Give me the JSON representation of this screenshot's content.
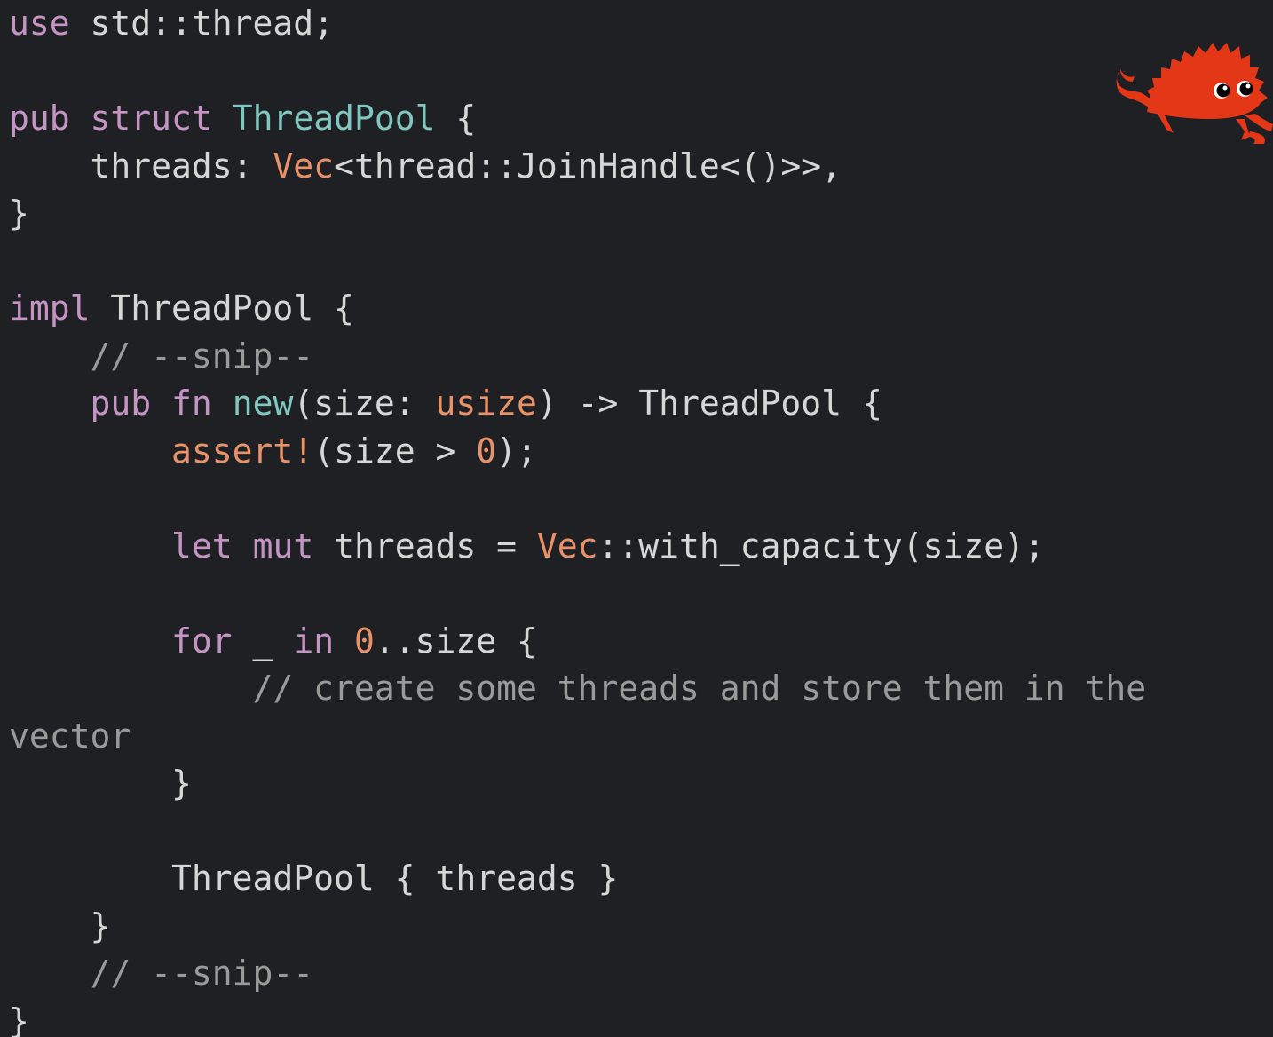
{
  "colors": {
    "background": "#1f2023",
    "default_text": "#d6d6d6",
    "keyword": "#c594c5",
    "type": "#7fc7bf",
    "builtin": "#e9926a",
    "comment": "#9a9a9a",
    "mascot": "#e43717"
  },
  "mascot": {
    "icon": "ferris-crab-icon"
  },
  "code": {
    "language": "rust",
    "lines": [
      [
        {
          "t": "use",
          "k": "keyword"
        },
        {
          "t": " std::thread;",
          "k": "default"
        }
      ],
      [],
      [
        {
          "t": "pub",
          "k": "keyword"
        },
        {
          "t": " ",
          "k": "default"
        },
        {
          "t": "struct",
          "k": "keyword"
        },
        {
          "t": " ",
          "k": "default"
        },
        {
          "t": "ThreadPool",
          "k": "type"
        },
        {
          "t": " {",
          "k": "punct"
        }
      ],
      [
        {
          "t": "    threads: ",
          "k": "default"
        },
        {
          "t": "Vec",
          "k": "builtin"
        },
        {
          "t": "<thread::JoinHandle<()>>,",
          "k": "default"
        }
      ],
      [
        {
          "t": "}",
          "k": "punct"
        }
      ],
      [],
      [
        {
          "t": "impl",
          "k": "keyword"
        },
        {
          "t": " ThreadPool {",
          "k": "default"
        }
      ],
      [
        {
          "t": "    ",
          "k": "default"
        },
        {
          "t": "// --snip--",
          "k": "comment"
        }
      ],
      [
        {
          "t": "    ",
          "k": "default"
        },
        {
          "t": "pub",
          "k": "keyword"
        },
        {
          "t": " ",
          "k": "default"
        },
        {
          "t": "fn",
          "k": "keyword"
        },
        {
          "t": " ",
          "k": "default"
        },
        {
          "t": "new",
          "k": "fn"
        },
        {
          "t": "(size: ",
          "k": "default"
        },
        {
          "t": "usize",
          "k": "builtin"
        },
        {
          "t": ") -> ThreadPool {",
          "k": "default"
        }
      ],
      [
        {
          "t": "        ",
          "k": "default"
        },
        {
          "t": "assert!",
          "k": "macro"
        },
        {
          "t": "(size > ",
          "k": "default"
        },
        {
          "t": "0",
          "k": "number"
        },
        {
          "t": ");",
          "k": "default"
        }
      ],
      [],
      [
        {
          "t": "        ",
          "k": "default"
        },
        {
          "t": "let",
          "k": "keyword"
        },
        {
          "t": " ",
          "k": "default"
        },
        {
          "t": "mut",
          "k": "keyword"
        },
        {
          "t": " threads = ",
          "k": "default"
        },
        {
          "t": "Vec",
          "k": "builtin"
        },
        {
          "t": "::with_capacity(size);",
          "k": "default"
        }
      ],
      [],
      [
        {
          "t": "        ",
          "k": "default"
        },
        {
          "t": "for",
          "k": "keyword"
        },
        {
          "t": " _ ",
          "k": "default"
        },
        {
          "t": "in",
          "k": "keyword"
        },
        {
          "t": " ",
          "k": "default"
        },
        {
          "t": "0",
          "k": "number"
        },
        {
          "t": "..size {",
          "k": "default"
        }
      ],
      [
        {
          "t": "            ",
          "k": "default"
        },
        {
          "t": "// create some threads and store them in the",
          "k": "comment"
        }
      ],
      [
        {
          "t": "vector",
          "k": "comment"
        }
      ],
      [
        {
          "t": "        }",
          "k": "default"
        }
      ],
      [],
      [
        {
          "t": "        ThreadPool { threads }",
          "k": "default"
        }
      ],
      [
        {
          "t": "    }",
          "k": "default"
        }
      ],
      [
        {
          "t": "    ",
          "k": "default"
        },
        {
          "t": "// --snip--",
          "k": "comment"
        }
      ],
      [
        {
          "t": "}",
          "k": "default"
        }
      ]
    ]
  }
}
